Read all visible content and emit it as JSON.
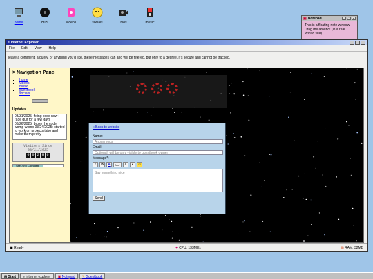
{
  "desktop": {
    "icons": [
      {
        "label": "home",
        "icon": "computer-icon",
        "active": true
      },
      {
        "label": "BTS",
        "icon": "gear-icon"
      },
      {
        "label": "videos",
        "icon": "cassette-icon"
      },
      {
        "label": "socials",
        "icon": "smiley-icon"
      },
      {
        "label": "bios",
        "icon": "film-camera-icon"
      },
      {
        "label": "music",
        "icon": "ipod-icon"
      }
    ]
  },
  "notepad": {
    "title": "Notepad",
    "text": "This is a floating note window. Drag me around! (in a real Win98 site)"
  },
  "browser": {
    "title": "Internet Explorer",
    "menu": [
      "File",
      "Edit",
      "View",
      "Help"
    ],
    "message": "leave a comment, a query, or anything you'd like. these messages can and will be filtered, but only to a degree. it's secure and cannot be tracked."
  },
  "sidebar": {
    "title": "> Navigation Panel",
    "links": [
      "home",
      "videos",
      "music",
      "guestbook",
      "socials"
    ],
    "updates_heading": "Updates",
    "updates": "03/31/2025: fixing code now i rage quit for a few days 03/26/2025: broke the code, womp womp 03/24/2025: started to work on projects tabo and make them pretty",
    "counter_label": "Visitors Since",
    "counter_date": "03/21/2025",
    "counter_digits": [
      "0",
      "0",
      "2",
      "9",
      "6"
    ],
    "progress": {
      "label": "Site 75% Complete",
      "percent": 60
    }
  },
  "form": {
    "back_link": "« Back to website",
    "name_label": "Name:",
    "name_placeholder": "Anonymous",
    "email_label": "Email:",
    "email_placeholder": "Optional, will be only visible to guestbook owner",
    "message_label": "Message*:",
    "message_placeholder": "Say something nice",
    "format_buttons": [
      "I",
      "B",
      "A",
      "font",
      "a",
      "img",
      "☺"
    ],
    "send_label": "Send"
  },
  "status": {
    "ready": "Ready",
    "cpu": "CPU: 133MHz",
    "ram": "RAM: 32MB"
  },
  "taskbar": {
    "start": "Start",
    "tasks": [
      "Internet explorer",
      "Notepad",
      "Guestbook"
    ]
  }
}
